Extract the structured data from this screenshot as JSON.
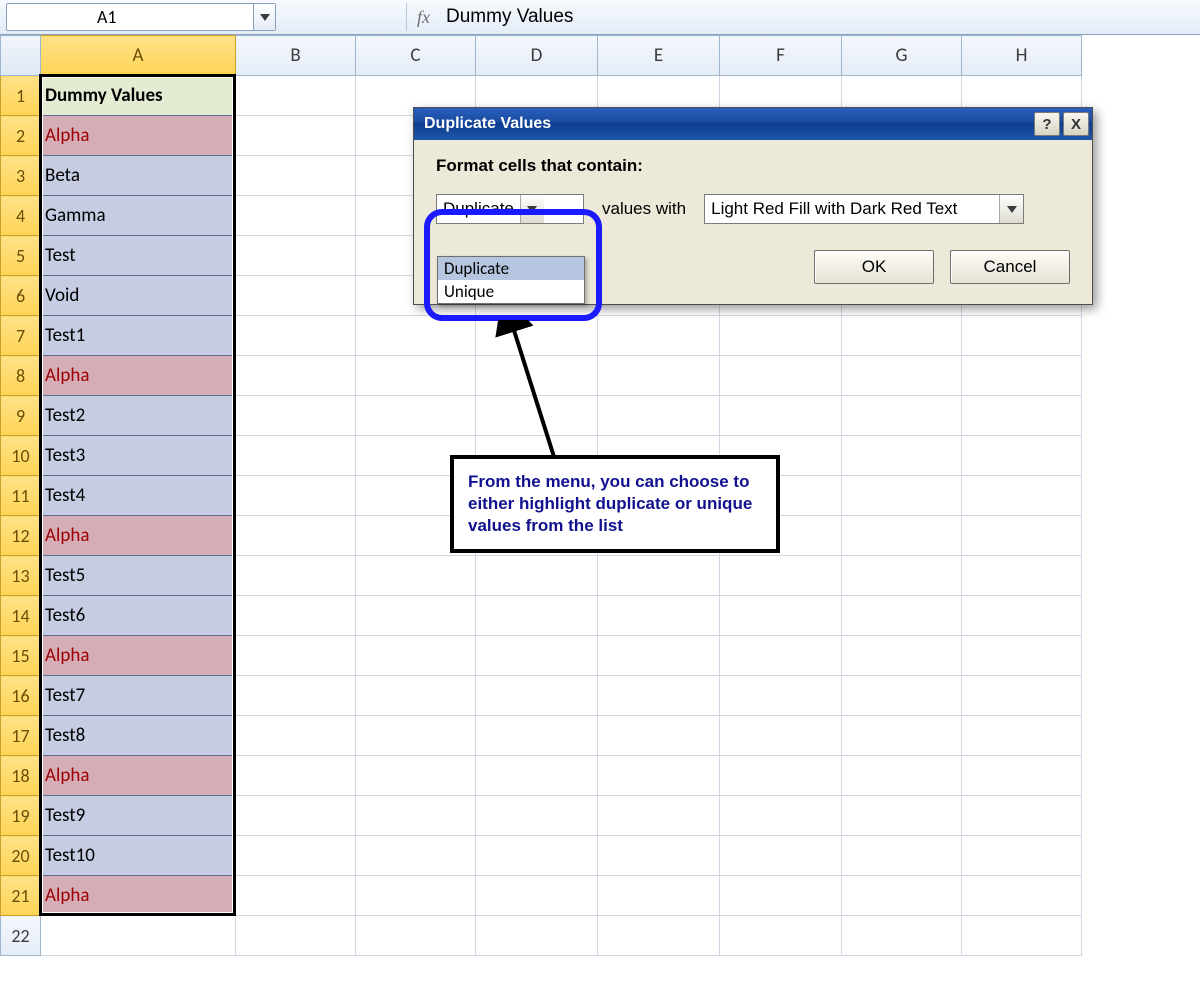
{
  "formula_bar": {
    "name_box": "A1",
    "fx_label": "fx",
    "formula": "Dummy Values"
  },
  "columns": [
    "A",
    "B",
    "C",
    "D",
    "E",
    "F",
    "G",
    "H"
  ],
  "rows": [
    1,
    2,
    3,
    4,
    5,
    6,
    7,
    8,
    9,
    10,
    11,
    12,
    13,
    14,
    15,
    16,
    17,
    18,
    19,
    20,
    21,
    22
  ],
  "colA": [
    {
      "v": "Dummy Values",
      "style": "hdrcell"
    },
    {
      "v": "Alpha",
      "style": "dup"
    },
    {
      "v": "Beta",
      "style": ""
    },
    {
      "v": "Gamma",
      "style": ""
    },
    {
      "v": "Test",
      "style": ""
    },
    {
      "v": "Void",
      "style": ""
    },
    {
      "v": "Test1",
      "style": ""
    },
    {
      "v": "Alpha",
      "style": "dup"
    },
    {
      "v": "Test2",
      "style": ""
    },
    {
      "v": "Test3",
      "style": ""
    },
    {
      "v": "Test4",
      "style": ""
    },
    {
      "v": "Alpha",
      "style": "dup"
    },
    {
      "v": "Test5",
      "style": ""
    },
    {
      "v": "Test6",
      "style": ""
    },
    {
      "v": "Alpha",
      "style": "dup"
    },
    {
      "v": "Test7",
      "style": ""
    },
    {
      "v": "Test8",
      "style": ""
    },
    {
      "v": "Alpha",
      "style": "dup"
    },
    {
      "v": "Test9",
      "style": ""
    },
    {
      "v": "Test10",
      "style": ""
    },
    {
      "v": "Alpha",
      "style": "dup"
    },
    {
      "v": "",
      "style": "blank"
    }
  ],
  "dialog": {
    "title": "Duplicate Values",
    "help": "?",
    "close": "X",
    "instruction": "Format cells that contain:",
    "mode_selected": "Duplicate",
    "mode_options": [
      "Duplicate",
      "Unique"
    ],
    "values_with_label": "values with",
    "style_selected": "Light Red Fill with Dark Red Text",
    "ok": "OK",
    "cancel": "Cancel"
  },
  "annotation": {
    "text": "From the menu, you can choose to either highlight duplicate or unique values from the list"
  }
}
